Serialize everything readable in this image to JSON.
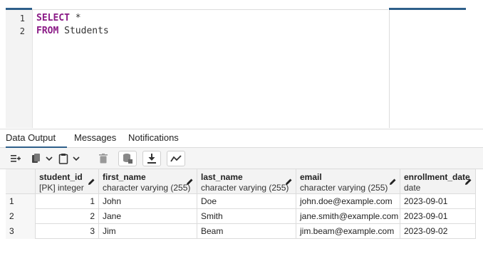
{
  "editor": {
    "lines": [
      {
        "number": "1",
        "keyword": "SELECT",
        "rest": " *"
      },
      {
        "number": "2",
        "keyword": "FROM",
        "rest": " Students"
      }
    ]
  },
  "tabs": [
    {
      "label": "Data Output",
      "active": true
    },
    {
      "label": "Messages",
      "active": false
    },
    {
      "label": "Notifications",
      "active": false
    }
  ],
  "toolbar": {
    "icons": [
      "add-row-icon",
      "copy-icon",
      "paste-icon",
      "delete-icon",
      "save-data-icon",
      "download-icon",
      "graph-visualiser-icon"
    ]
  },
  "grid": {
    "columns": [
      {
        "name": "student_id",
        "type": "[PK] integer"
      },
      {
        "name": "first_name",
        "type": "character varying (255)"
      },
      {
        "name": "last_name",
        "type": "character varying (255)"
      },
      {
        "name": "email",
        "type": "character varying (255)"
      },
      {
        "name": "enrollment_date",
        "type": "date"
      }
    ],
    "rows": [
      {
        "row": "1",
        "cells": [
          "1",
          "John",
          "Doe",
          "john.doe@example.com",
          "2023-09-01"
        ]
      },
      {
        "row": "2",
        "cells": [
          "2",
          "Jane",
          "Smith",
          "jane.smith@example.com",
          "2023-09-01"
        ]
      },
      {
        "row": "3",
        "cells": [
          "3",
          "Jim",
          "Beam",
          "jim.beam@example.com",
          "2023-09-02"
        ]
      }
    ]
  },
  "colors": {
    "accent": "#2e5f8a",
    "keyword": "#8a1a86"
  }
}
